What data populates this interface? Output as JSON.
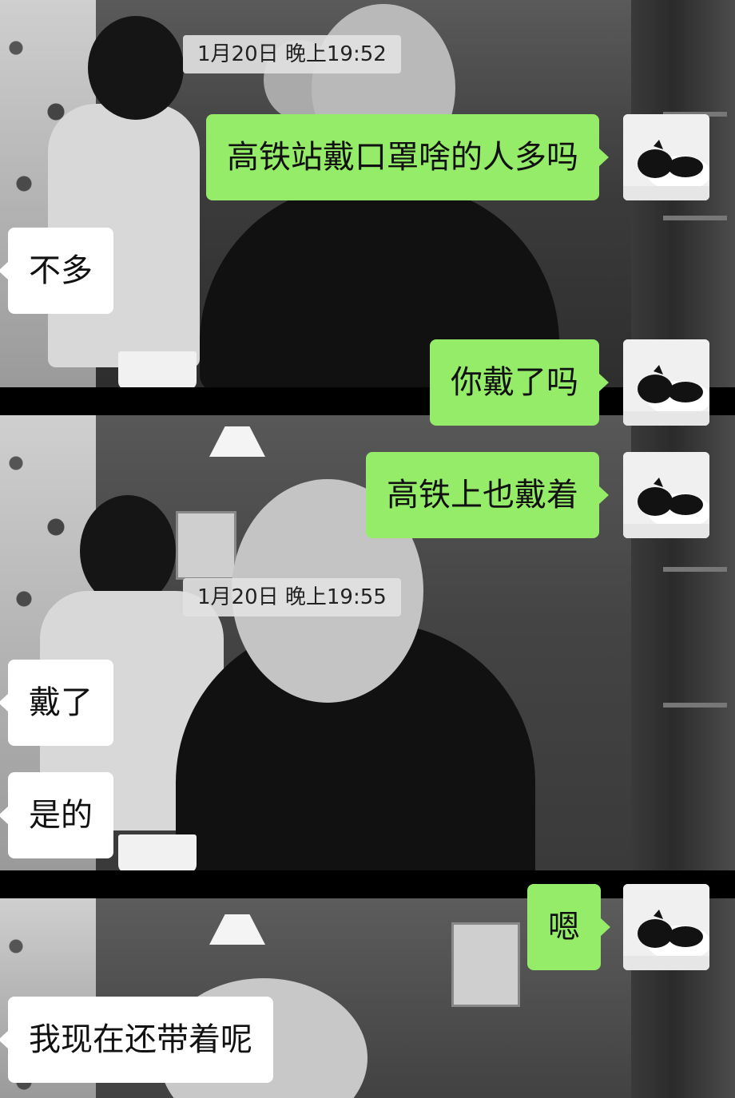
{
  "timestamps": [
    "1月20日 晚上19:52",
    "1月20日 晚上19:55"
  ],
  "messages": [
    {
      "side": "right",
      "text": "高铁站戴口罩啥的人多吗"
    },
    {
      "side": "left",
      "text": "不多"
    },
    {
      "side": "right",
      "text": "你戴了吗"
    },
    {
      "side": "right",
      "text": "高铁上也戴着"
    },
    {
      "side": "left",
      "text": "戴了"
    },
    {
      "side": "left",
      "text": "是的"
    },
    {
      "side": "right",
      "text": "嗯"
    },
    {
      "side": "left",
      "text": "我现在还带着呢"
    }
  ],
  "avatar": {
    "icon": "black-white-cat-avatar-icon"
  },
  "colors": {
    "self_bubble": "#95ec69",
    "other_bubble": "#ffffff",
    "timestamp_bg": "#e1e1e1"
  }
}
